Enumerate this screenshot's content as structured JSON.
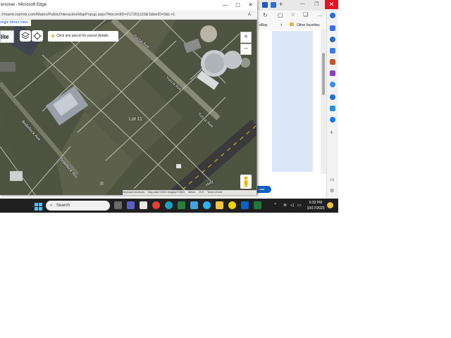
{
  "popup": {
    "title": "ersonal - Microsoft Edge",
    "url": "://matrix.harmls.com/Matrix/Public/InteractiveMapPopup.aspx?RecordID=217201133&TableID=9&L=1",
    "reader_icon": "A"
  },
  "map": {
    "street_view_link": "oogle Street View",
    "map_type": "lite",
    "hint": "Click any parcel for parcel details.",
    "lot_label": "Lot 11",
    "zoom_in": "+",
    "zoom_out": "−",
    "streets": [
      "Yucca Ave",
      "Yucca Ave",
      "Yucca Ave",
      "Bellefleck Ave",
      "Bellefleck Ave",
      "Hwy"
    ],
    "attribution": [
      "Keyboard shortcuts",
      "Map data ©2023 Imagery ©2023",
      "Airbus",
      "20 ft",
      "Terms of Use"
    ]
  },
  "background_browser": {
    "favorites": [
      "eBay",
      "Other favorites"
    ],
    "smart_button": "mart"
  },
  "taskbar": {
    "search_placeholder": "Search",
    "time": "6:33 PM",
    "date": "10/17/2023",
    "apps": [
      "file-explorer-icon",
      "teams-icon",
      "store-icon",
      "chrome-icon",
      "edge-icon",
      "mail-icon",
      "l-app-icon",
      "cortana-icon",
      "folder-icon",
      "norton-icon",
      "outlook-icon",
      "excel-icon"
    ]
  },
  "colors": {
    "taskbar": "#202020",
    "close_red": "#e81123",
    "accent_blue": "#0f62c4"
  }
}
